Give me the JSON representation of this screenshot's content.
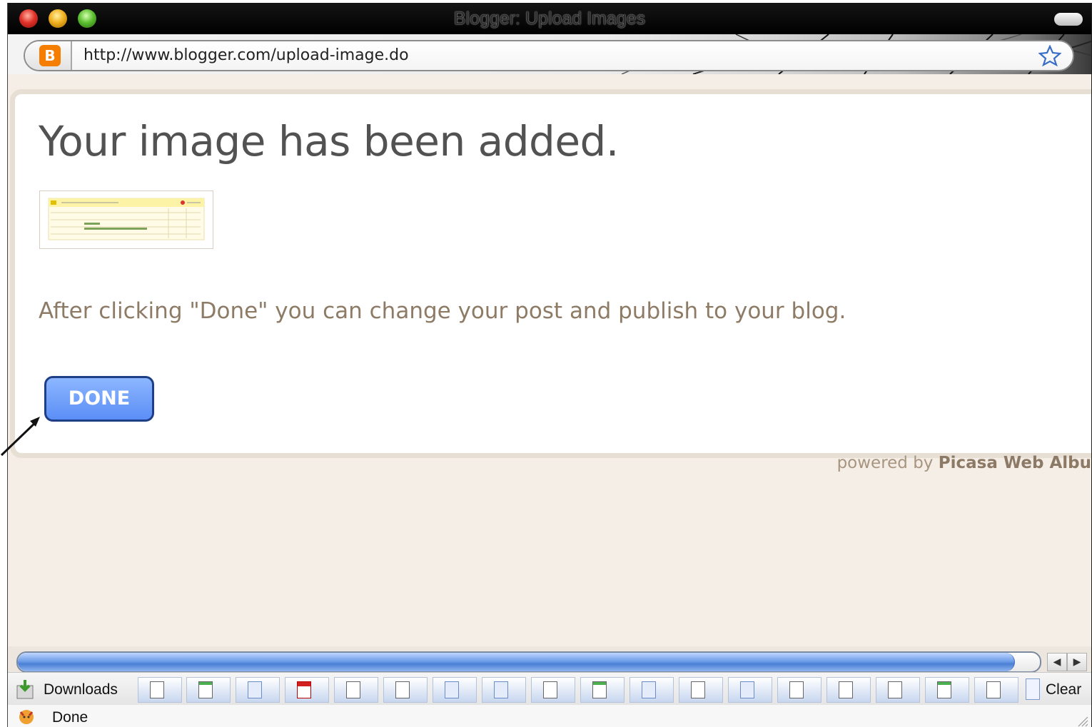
{
  "window": {
    "title": "Blogger: Upload Images"
  },
  "address_bar": {
    "url": "http://www.blogger.com/upload-image.do",
    "site_icon": "blogger-icon",
    "bookmark_icon": "star-icon"
  },
  "page": {
    "headline": "Your image has been added.",
    "info": "After clicking \"Done\" you can change your post and publish to your blog.",
    "done_label": "DONE",
    "powered_prefix": "powered by",
    "powered_brand": "Picasa Web Albu"
  },
  "downloads_bar": {
    "label": "Downloads",
    "clear_label": "Clear",
    "files": [
      "word-file-icon",
      "text-file-icon",
      "text-file-icon",
      "pdf-file-icon",
      "word-file-icon",
      "word-file-icon",
      "text-file-icon",
      "text-file-icon",
      "doc-file-icon",
      "text-file-icon",
      "text-file-icon",
      "doc-file-icon",
      "text-file-icon",
      "doc-file-icon",
      "doc-file-icon",
      "doc-file-icon",
      "text-file-icon",
      "word-file-icon"
    ]
  },
  "status_bar": {
    "text": "Done"
  },
  "colors": {
    "done_button": "#5b8ef6",
    "headline": "#525252",
    "info_text": "#8e7b66",
    "page_bg": "#f5eee6"
  }
}
